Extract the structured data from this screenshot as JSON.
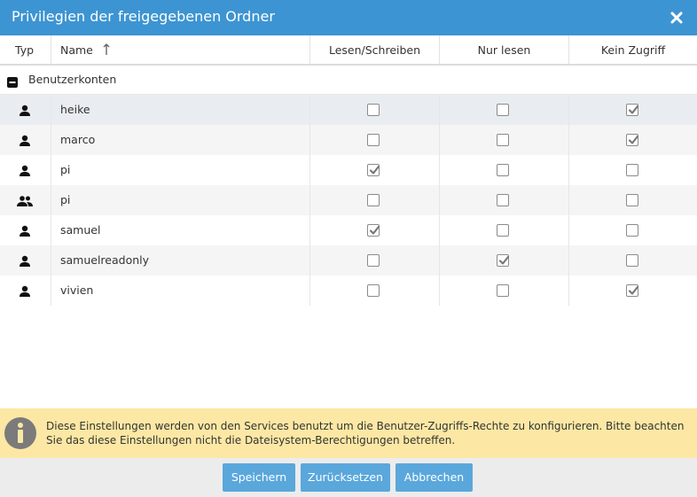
{
  "dialog": {
    "title": "Privilegien der freigegebenen Ordner",
    "close_icon": "close-icon"
  },
  "columns": {
    "type": "Typ",
    "name": "Name",
    "read_write": "Lesen/Schreiben",
    "read_only": "Nur lesen",
    "no_access": "Kein Zugriff"
  },
  "group": {
    "label": "Benutzerkonten",
    "icon": "collapse-icon"
  },
  "rows": [
    {
      "type": "user",
      "name": "heike",
      "read_write": false,
      "read_only": false,
      "no_access": true
    },
    {
      "type": "user",
      "name": "marco",
      "read_write": false,
      "read_only": false,
      "no_access": true
    },
    {
      "type": "user",
      "name": "pi",
      "read_write": true,
      "read_only": false,
      "no_access": false
    },
    {
      "type": "group",
      "name": "pi",
      "read_write": false,
      "read_only": false,
      "no_access": false
    },
    {
      "type": "user",
      "name": "samuel",
      "read_write": true,
      "read_only": false,
      "no_access": false
    },
    {
      "type": "user",
      "name": "samuelreadonly",
      "read_write": false,
      "read_only": true,
      "no_access": false
    },
    {
      "type": "user",
      "name": "vivien",
      "read_write": false,
      "read_only": false,
      "no_access": true
    }
  ],
  "info": {
    "text": "Diese Einstellungen werden von den Services benutzt um die Benutzer-Zugriffs-Rechte zu konfigurieren. Bitte beachten Sie das diese Einstellungen nicht die Dateisystem-Berechtigungen betreffen."
  },
  "buttons": {
    "save": "Speichern",
    "reset": "Zurücksetzen",
    "cancel": "Abbrechen"
  },
  "colors": {
    "titlebar": "#3d94d2",
    "button": "#5aa7dc",
    "info_bg": "#fce8a4",
    "footer": "#ececec"
  }
}
